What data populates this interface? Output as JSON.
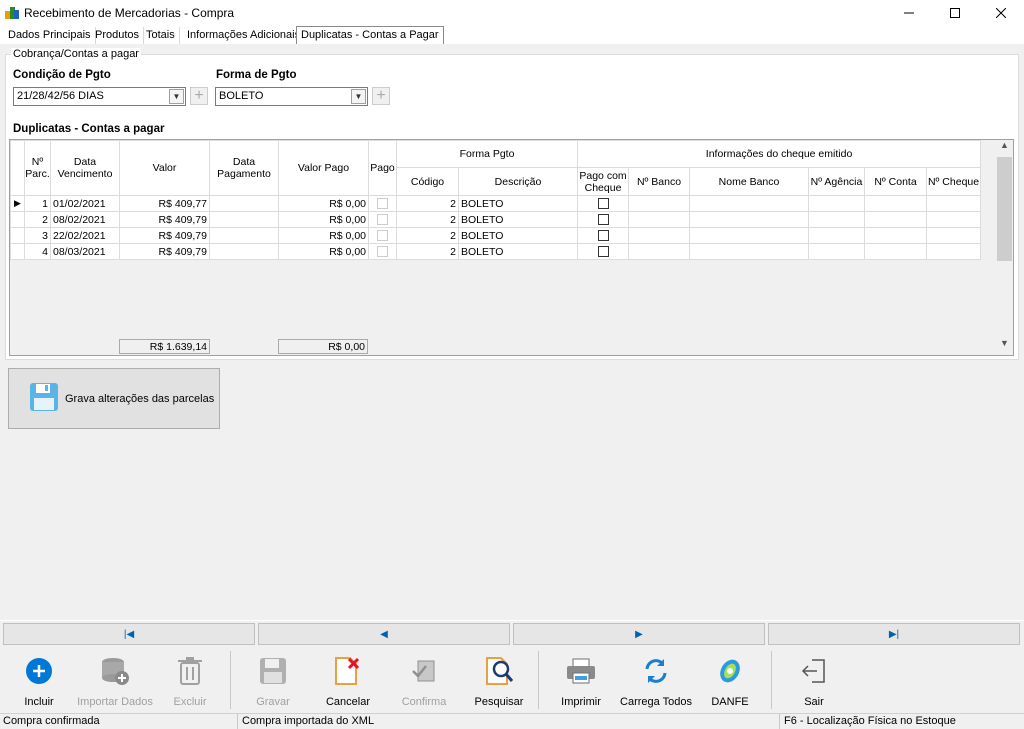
{
  "window": {
    "title": "Recebimento de Mercadorias - Compra"
  },
  "tabs": [
    "Dados Principais",
    "Produtos",
    "Totais",
    "Informações Adicionais",
    "Duplicatas - Contas a Pagar"
  ],
  "group": {
    "title": "Cobrança/Contas a pagar"
  },
  "condicao": {
    "label": "Condição de Pgto",
    "value": "21/28/42/56 DIAS"
  },
  "forma": {
    "label": "Forma de Pgto",
    "value": "BOLETO"
  },
  "grid": {
    "title": "Duplicatas - Contas a pagar",
    "headers": {
      "parc": "Nº Parc.",
      "venc": "Data Vencimento",
      "valor": "Valor",
      "pagamento": "Data Pagamento",
      "valor_pago": "Valor Pago",
      "pago": "Pago",
      "forma_pgto": "Forma Pgto",
      "codigo": "Código",
      "descricao": "Descrição",
      "info_cheque": "Informações do cheque emitido",
      "pago_cheque": "Pago com Cheque",
      "banco": "Nº Banco",
      "nome_banco": "Nome Banco",
      "agencia": "Nº Agência",
      "conta": "Nº Conta",
      "cheque": "Nº Cheque"
    },
    "rows": [
      {
        "parc": "1",
        "venc": "01/02/2021",
        "valor": "R$ 409,77",
        "valor_pago": "R$ 0,00",
        "codigo": "2",
        "descricao": "BOLETO"
      },
      {
        "parc": "2",
        "venc": "08/02/2021",
        "valor": "R$ 409,79",
        "valor_pago": "R$ 0,00",
        "codigo": "2",
        "descricao": "BOLETO"
      },
      {
        "parc": "3",
        "venc": "22/02/2021",
        "valor": "R$ 409,79",
        "valor_pago": "R$ 0,00",
        "codigo": "2",
        "descricao": "BOLETO"
      },
      {
        "parc": "4",
        "venc": "08/03/2021",
        "valor": "R$ 409,79",
        "valor_pago": "R$ 0,00",
        "codigo": "2",
        "descricao": "BOLETO"
      }
    ],
    "total_valor": "R$ 1.639,14",
    "total_pago": "R$ 0,00"
  },
  "save_button": "Grava alterações das parcelas",
  "toolbar": [
    "Incluir",
    "Importar Dados",
    "Excluir",
    "Gravar",
    "Cancelar",
    "Confirma",
    "Pesquisar",
    "Imprimir",
    "Carrega Todos",
    "DANFE",
    "Sair"
  ],
  "status": {
    "left": "Compra confirmada",
    "middle": "Compra importada do XML",
    "right": "F6 - Localização Física no Estoque"
  },
  "colors": {
    "accent": "#0078d7",
    "nav_arrow": "#0063b1",
    "cancel_red": "#e81123"
  }
}
